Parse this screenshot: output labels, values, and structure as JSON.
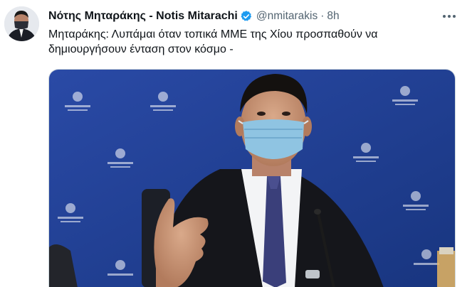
{
  "tweet": {
    "display_name": "Νότης Μηταράκης - Notis Mitarachi",
    "handle": "@nmitarakis",
    "separator": "·",
    "time": "8h",
    "text_line1": "Μηταράκης: Λυπάμαι όταν τοπικά ΜΜΕ της Χίου προσπαθούν να",
    "text_line2": "δημιουργήσουν ένταση στον κόσμο -"
  },
  "icons": {
    "verified": "verified-badge-icon",
    "more": "more-options-icon"
  },
  "colors": {
    "verified_blue": "#1d9bf0",
    "secondary_text": "#536471",
    "backdrop_blue": "#1f3f95"
  }
}
